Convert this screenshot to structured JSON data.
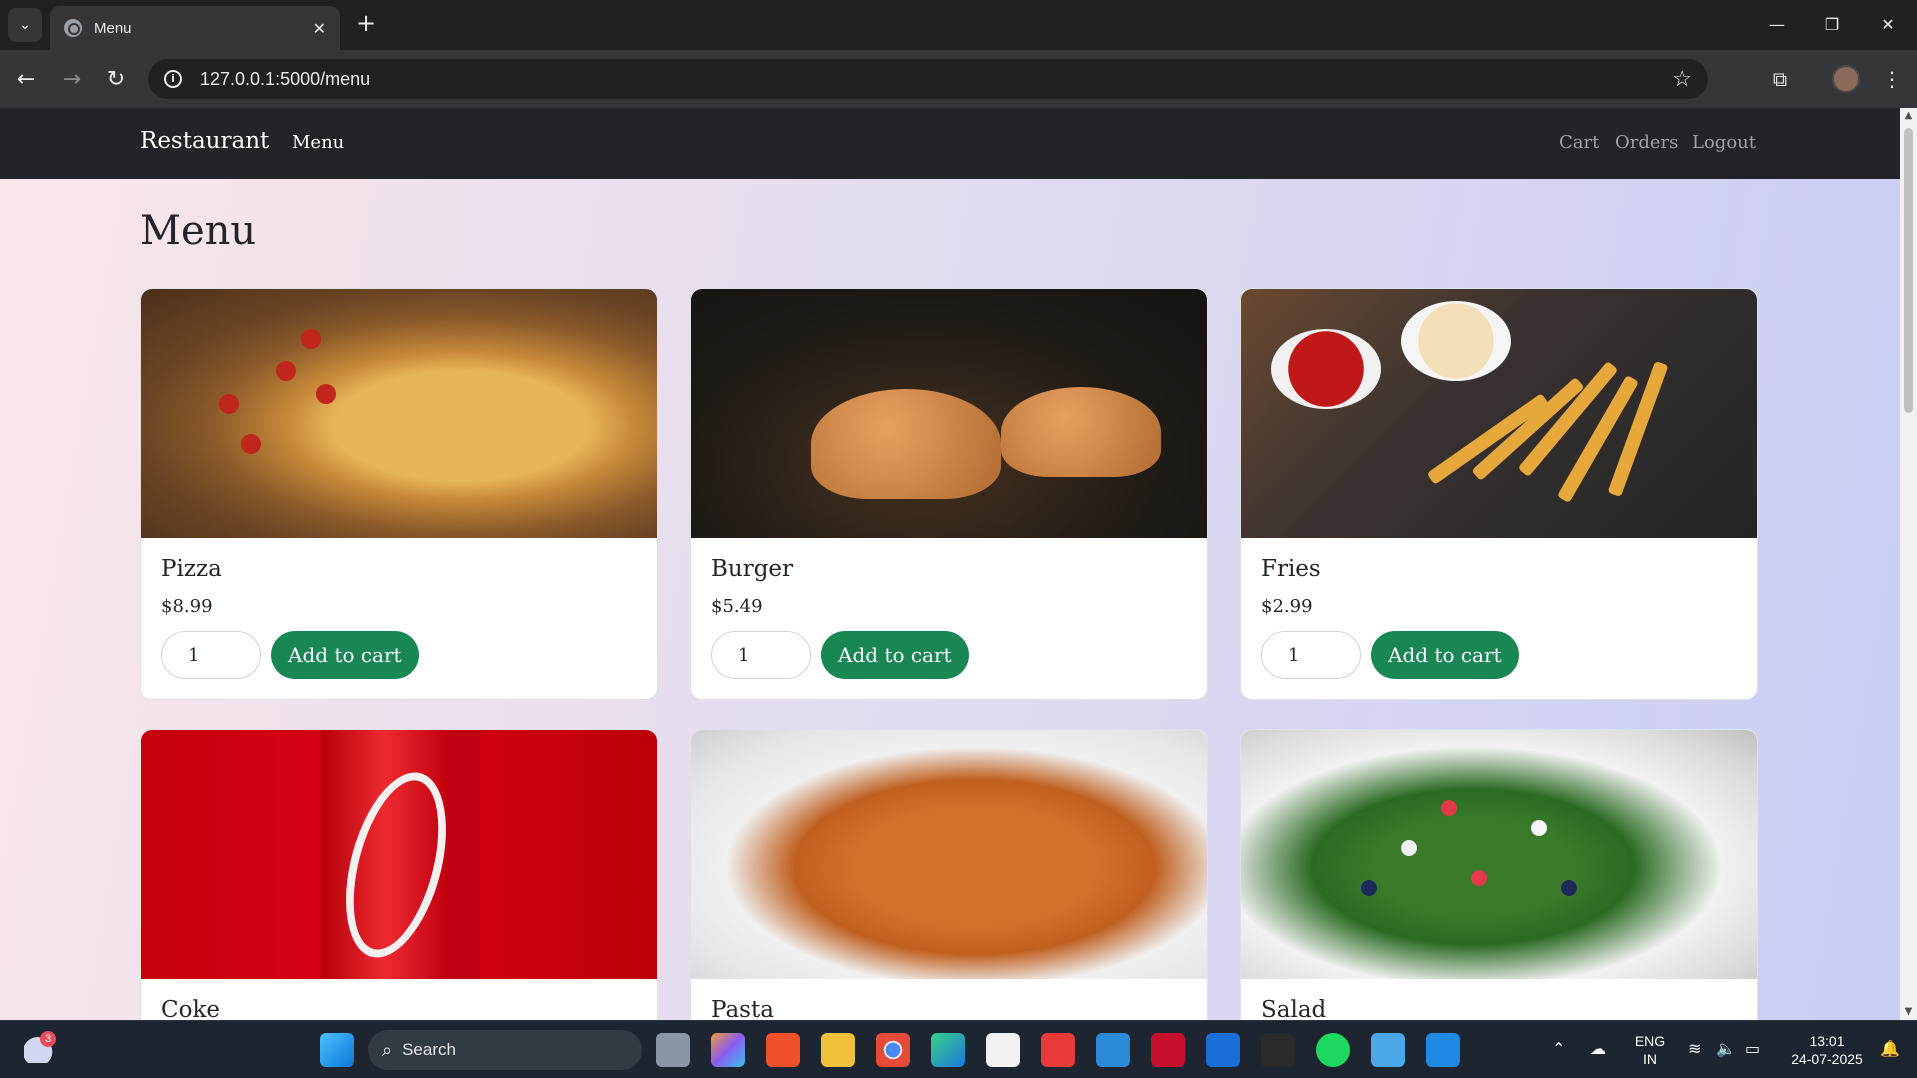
{
  "browser": {
    "tab_title": "Menu",
    "tab_close": "✕",
    "new_tab": "+",
    "url": "127.0.0.1:5000/menu"
  },
  "navbar": {
    "brand": "Restaurant",
    "menu_link": "Menu",
    "right_links": [
      "Cart",
      "Orders",
      "Logout"
    ]
  },
  "page": {
    "title": "Menu"
  },
  "menu_items": [
    {
      "name": "Pizza",
      "price": "$8.99",
      "qty": "1",
      "button": "Add to cart"
    },
    {
      "name": "Burger",
      "price": "$5.49",
      "qty": "1",
      "button": "Add to cart"
    },
    {
      "name": "Fries",
      "price": "$2.99",
      "qty": "1",
      "button": "Add to cart"
    },
    {
      "name": "Coke"
    },
    {
      "name": "Pasta"
    },
    {
      "name": "Salad"
    }
  ],
  "taskbar": {
    "search_placeholder": "Search",
    "weather_badge": "3",
    "language": "ENG",
    "region": "IN",
    "time": "13:01",
    "date": "24-07-2025"
  },
  "colors": {
    "navbar_bg": "#212529",
    "accent_button": "#198754",
    "page_gradient_start": "#fbe6ea",
    "page_gradient_end": "#c9cdf4"
  }
}
